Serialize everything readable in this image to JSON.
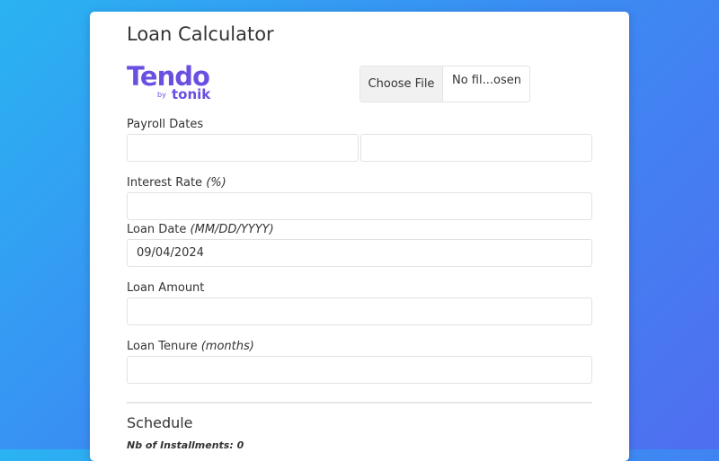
{
  "app": {
    "title": "Loan Calculator",
    "logo_main": "Tendo",
    "logo_by": "by",
    "logo_sub": "tonik"
  },
  "file_input": {
    "button_label": "Choose File",
    "status": "No fil...osen"
  },
  "payroll": {
    "label": "Payroll Dates",
    "date1": "",
    "date2": ""
  },
  "interest": {
    "label": "Interest Rate",
    "unit": "(%)",
    "value": ""
  },
  "loan_date": {
    "label": "Loan Date",
    "format": "(MM/DD/YYYY)",
    "value": "09/04/2024"
  },
  "loan_amount": {
    "label": "Loan Amount",
    "value": ""
  },
  "loan_tenure": {
    "label": "Loan Tenure",
    "unit": "(months)",
    "value": ""
  },
  "schedule": {
    "title": "Schedule",
    "installments_label": "Nb of Installments: 0"
  },
  "colors": {
    "brand": "#6b4fe0",
    "bg_start": "#2ab3f2",
    "bg_end": "#4f6ef0"
  }
}
